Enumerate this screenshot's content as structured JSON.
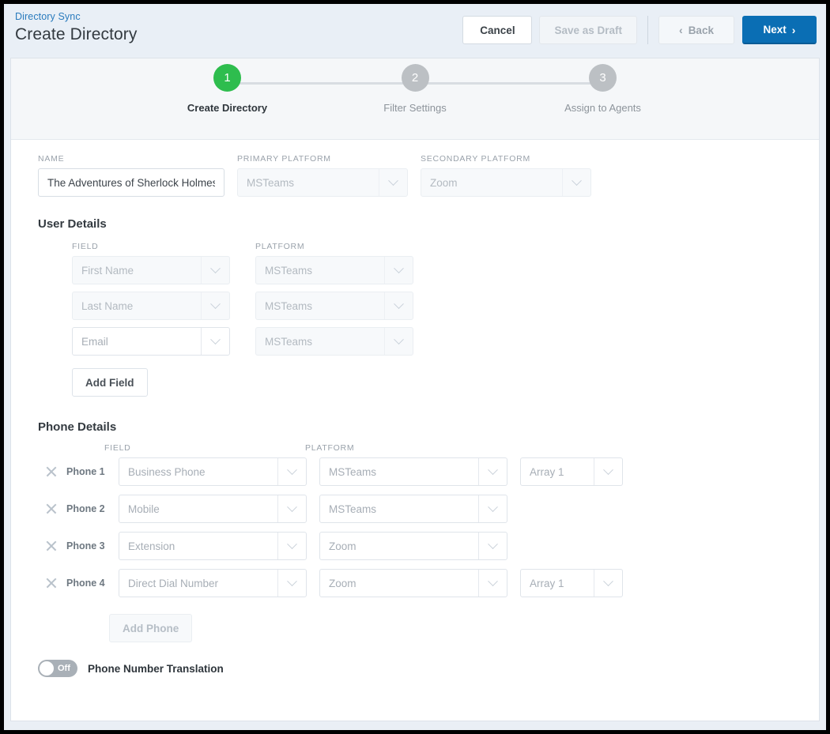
{
  "header": {
    "breadcrumb": "Directory Sync",
    "title": "Create Directory",
    "buttons": {
      "cancel": "Cancel",
      "save_draft": "Save as Draft",
      "back": "Back",
      "next": "Next"
    },
    "icons": {
      "back_chevron": "‹",
      "next_chevron": "›"
    }
  },
  "stepper": {
    "steps": [
      {
        "number": "1",
        "label": "Create Directory",
        "state": "active"
      },
      {
        "number": "2",
        "label": "Filter Settings",
        "state": "inactive"
      },
      {
        "number": "3",
        "label": "Assign to Agents",
        "state": "inactive"
      }
    ],
    "active_color": "#2ebd4e",
    "inactive_color": "#bcc0c4"
  },
  "form": {
    "name": {
      "label": "NAME",
      "value": "The Adventures of Sherlock Holmes",
      "placeholder": ""
    },
    "primary_platform": {
      "label": "PRIMARY PLATFORM",
      "value": "MSTeams"
    },
    "secondary_platform": {
      "label": "SECONDARY PLATFORM",
      "value": "Zoom"
    }
  },
  "user_details": {
    "title": "User Details",
    "columns": {
      "field": "FIELD",
      "platform": "PLATFORM"
    },
    "rows": [
      {
        "field": "First Name",
        "platform": "MSTeams",
        "field_state": "disabled",
        "platform_state": "disabled"
      },
      {
        "field": "Last Name",
        "platform": "MSTeams",
        "field_state": "disabled",
        "platform_state": "disabled"
      },
      {
        "field": "Email",
        "platform": "MSTeams",
        "field_state": "enabled",
        "platform_state": "disabled"
      }
    ],
    "add_button": "Add Field"
  },
  "phone_details": {
    "title": "Phone Details",
    "columns": {
      "field": "FIELD",
      "platform": "PLATFORM"
    },
    "rows": [
      {
        "name": "Phone 1",
        "field": "Business Phone",
        "platform": "MSTeams",
        "array": "Array 1",
        "has_array": true
      },
      {
        "name": "Phone 2",
        "field": "Mobile",
        "platform": "MSTeams",
        "array": "",
        "has_array": false
      },
      {
        "name": "Phone 3",
        "field": "Extension",
        "platform": "Zoom",
        "array": "",
        "has_array": false
      },
      {
        "name": "Phone 4",
        "field": "Direct Dial Number",
        "platform": "Zoom",
        "array": "Array 1",
        "has_array": true
      }
    ],
    "add_button": "Add Phone",
    "add_button_state": "disabled"
  },
  "phone_translation": {
    "state_label": "Off",
    "label": "Phone Number Translation",
    "enabled": false
  }
}
